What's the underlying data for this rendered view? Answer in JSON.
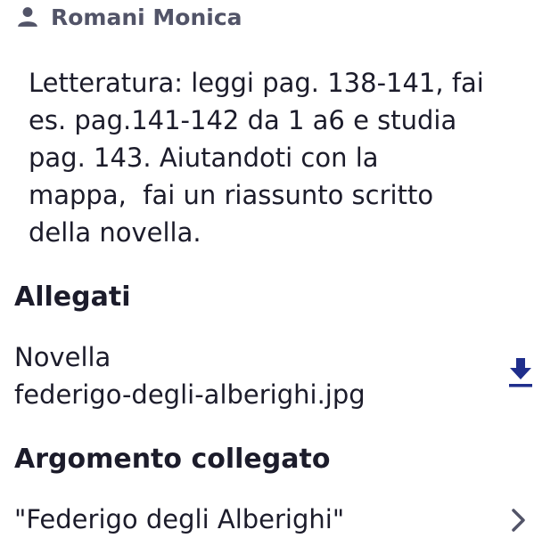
{
  "teacher": {
    "name": "Romani Monica",
    "icon": "person-icon"
  },
  "assignment": {
    "description": "Letteratura: leggi pag. 138-141, fai\nes. pag.141-142 da 1 a6 e studia\npag. 143. Aiutandoti con la\nmappa,  fai un riassunto scritto\ndella novella."
  },
  "attachments": {
    "title": "Allegati",
    "items": [
      {
        "name": "Novella\nfederigo-degli-alberighi.jpg",
        "icon": "download-icon"
      }
    ]
  },
  "related_topic": {
    "title": "Argomento collegato",
    "label": "\"Federigo degli Alberighi\"",
    "icon": "chevron-right-icon"
  },
  "colors": {
    "text": "#1c1c2b",
    "muted": "#525468",
    "accent": "#1f2e8c"
  }
}
